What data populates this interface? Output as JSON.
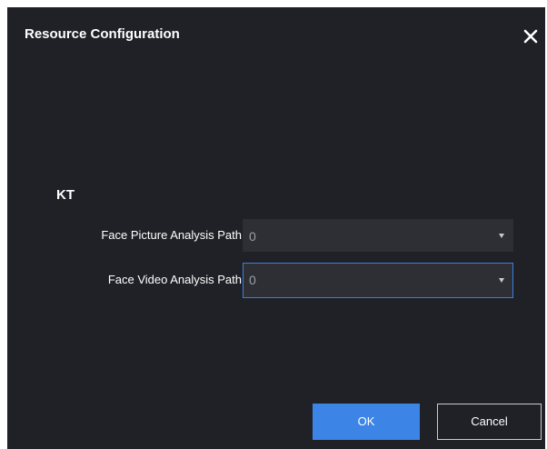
{
  "dialog": {
    "title": "Resource Configuration",
    "close_icon": "close-icon"
  },
  "section": {
    "title": "KT"
  },
  "fields": [
    {
      "label": "Face Picture Analysis Path",
      "value": "0"
    },
    {
      "label": "Face Video Analysis Path",
      "value": "0"
    }
  ],
  "buttons": {
    "ok_label": "OK",
    "cancel_label": "Cancel"
  },
  "colors": {
    "dialog_bg": "#1f2126",
    "select_bg": "#2d2f35",
    "accent": "#3c84e6",
    "focus_border": "#3a7ee0"
  }
}
